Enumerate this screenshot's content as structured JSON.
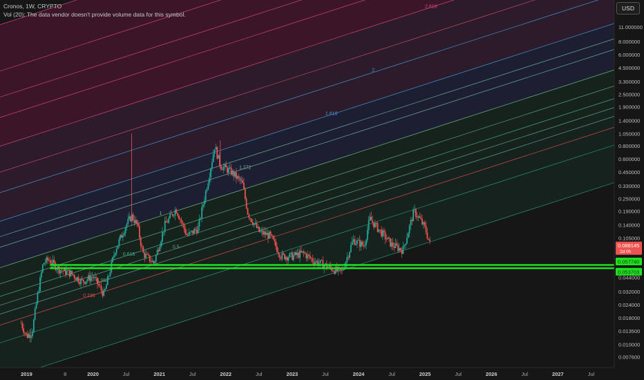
{
  "legend": {
    "symbol_line": "Cronos, 1W, CRYPTO",
    "volume_line": "Vol (20): The data vendor doesn't provide volume data for this symbol."
  },
  "currency_button": "USD",
  "colors": {
    "background": "#161616",
    "bull": "#26a69a",
    "bear": "#ef5350",
    "support": "#21e021"
  },
  "chart_data": {
    "type": "candlestick",
    "scale": "log",
    "ylim": [
      0.006,
      20
    ],
    "x_ticks": [
      "2019",
      "8",
      "2020",
      "Jul",
      "2021",
      "Jul",
      "2022",
      "Jul",
      "2023",
      "Jul",
      "2024",
      "Jul",
      "2025",
      "Jul",
      "2026",
      "Jul",
      "2027",
      "Jul"
    ],
    "y_ticks": [
      11.0,
      8.0,
      6.0,
      4.5,
      3.3,
      2.5,
      1.9,
      1.4,
      1.05,
      0.8,
      0.6,
      0.45,
      0.33,
      0.25,
      0.19,
      0.14,
      0.105,
      0.044,
      0.032,
      0.024,
      0.018,
      0.0135,
      0.01,
      0.0076
    ],
    "y_tick_labels": [
      "11.000000",
      "8.000000",
      "6.000000",
      "4.500000",
      "3.300000",
      "2.500000",
      "1.900000",
      "1.400000",
      "1.050000",
      "0.800000",
      "0.600000",
      "0.450000",
      "0.330000",
      "0.250000",
      "0.190000",
      "0.140000",
      "0.105000",
      "0.044000",
      "0.032000",
      "0.024000",
      "0.018000",
      "0.013500",
      "0.010000",
      "0.007600"
    ],
    "fib_channel_levels": [
      "0",
      "0.236",
      "0.382",
      "0.5",
      "0.618",
      "1",
      "1.272",
      "1.618",
      "2",
      "2.618",
      "3"
    ],
    "fib_channel_label_extra": "236",
    "price_points": [
      {
        "t": "2018-12",
        "p": 0.016
      },
      {
        "t": "2019-01",
        "p": 0.012
      },
      {
        "t": "2019-02",
        "p": 0.013
      },
      {
        "t": "2019-03",
        "p": 0.03
      },
      {
        "t": "2019-04",
        "p": 0.06
      },
      {
        "t": "2019-05",
        "p": 0.065
      },
      {
        "t": "2019-06",
        "p": 0.058
      },
      {
        "t": "2019-07",
        "p": 0.052
      },
      {
        "t": "2019-09",
        "p": 0.048
      },
      {
        "t": "2019-11",
        "p": 0.04
      },
      {
        "t": "2020-01",
        "p": 0.045
      },
      {
        "t": "2020-03",
        "p": 0.03
      },
      {
        "t": "2020-05",
        "p": 0.08
      },
      {
        "t": "2020-07",
        "p": 0.14
      },
      {
        "t": "2020-08",
        "p": 0.17
      },
      {
        "t": "2020-09",
        "p": 0.14
      },
      {
        "t": "2020-10",
        "p": 0.075
      },
      {
        "t": "2020-12",
        "p": 0.06
      },
      {
        "t": "2021-02",
        "p": 0.14
      },
      {
        "t": "2021-04",
        "p": 0.2
      },
      {
        "t": "2021-06",
        "p": 0.11
      },
      {
        "t": "2021-08",
        "p": 0.13
      },
      {
        "t": "2021-10",
        "p": 0.42
      },
      {
        "t": "2021-11",
        "p": 0.8
      },
      {
        "t": "2021-12",
        "p": 0.52
      },
      {
        "t": "2022-02",
        "p": 0.45
      },
      {
        "t": "2022-04",
        "p": 0.35
      },
      {
        "t": "2022-05",
        "p": 0.18
      },
      {
        "t": "2022-07",
        "p": 0.12
      },
      {
        "t": "2022-09",
        "p": 0.11
      },
      {
        "t": "2022-11",
        "p": 0.07
      },
      {
        "t": "2023-01",
        "p": 0.07
      },
      {
        "t": "2023-03",
        "p": 0.075
      },
      {
        "t": "2023-05",
        "p": 0.063
      },
      {
        "t": "2023-07",
        "p": 0.057
      },
      {
        "t": "2023-09",
        "p": 0.051
      },
      {
        "t": "2023-10",
        "p": 0.05
      },
      {
        "t": "2023-12",
        "p": 0.1
      },
      {
        "t": "2024-02",
        "p": 0.088
      },
      {
        "t": "2024-03",
        "p": 0.16
      },
      {
        "t": "2024-05",
        "p": 0.12
      },
      {
        "t": "2024-07",
        "p": 0.09
      },
      {
        "t": "2024-09",
        "p": 0.08
      },
      {
        "t": "2024-11",
        "p": 0.19
      },
      {
        "t": "2024-12",
        "p": 0.16
      },
      {
        "t": "2025-01",
        "p": 0.13
      },
      {
        "t": "2025-02",
        "p": 0.0881
      }
    ],
    "spike_highs": [
      {
        "t": "2020-08",
        "p": 1.05
      },
      {
        "t": "2021-12",
        "p": 0.9
      }
    ],
    "price_tag": {
      "value": "0.088145",
      "countdown": "2d 0h"
    },
    "support_lines": [
      {
        "value": 0.05774,
        "label": "0.057740"
      },
      {
        "value": 0.053703,
        "label": "0.053703"
      }
    ]
  }
}
